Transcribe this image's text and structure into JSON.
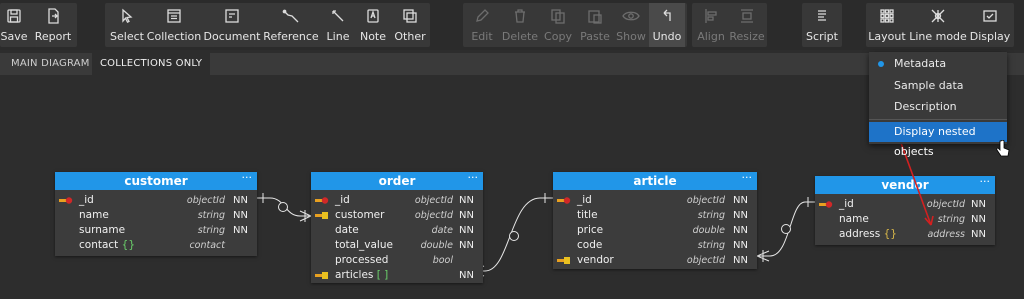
{
  "toolbar": {
    "buttons": [
      {
        "label": "Save",
        "icon": "save-icon"
      },
      {
        "label": "Report",
        "icon": "report-icon"
      },
      {
        "label": "Select",
        "icon": "cursor-icon"
      },
      {
        "label": "Collection",
        "icon": "collection-icon"
      },
      {
        "label": "Document",
        "icon": "document-icon"
      },
      {
        "label": "Reference",
        "icon": "reference-icon"
      },
      {
        "label": "Line",
        "icon": "line-icon"
      },
      {
        "label": "Note",
        "icon": "note-icon"
      },
      {
        "label": "Other",
        "icon": "other-icon"
      },
      {
        "label": "Edit",
        "icon": "edit-icon",
        "disabled": true
      },
      {
        "label": "Delete",
        "icon": "delete-icon",
        "disabled": true
      },
      {
        "label": "Copy",
        "icon": "copy-icon",
        "disabled": true
      },
      {
        "label": "Paste",
        "icon": "paste-icon",
        "disabled": true
      },
      {
        "label": "Show",
        "icon": "eye-icon",
        "disabled": true
      },
      {
        "label": "Undo",
        "icon": "undo-icon"
      },
      {
        "label": "Align",
        "icon": "align-icon",
        "disabled": true
      },
      {
        "label": "Resize",
        "icon": "resize-icon",
        "disabled": true
      },
      {
        "label": "Script",
        "icon": "script-icon"
      },
      {
        "label": "Layout",
        "icon": "layout-icon"
      },
      {
        "label": "Line mode",
        "icon": "line-mode-icon"
      },
      {
        "label": "Display",
        "icon": "display-icon"
      }
    ]
  },
  "tabs": [
    {
      "label": "MAIN DIAGRAM"
    },
    {
      "label": "COLLECTIONS ONLY",
      "active": true
    }
  ],
  "display_menu": {
    "items": [
      {
        "label": "Metadata",
        "selected": true
      },
      {
        "label": "Sample data"
      },
      {
        "label": "Description"
      },
      {
        "label": "Display nested objects",
        "highlighted": true
      }
    ]
  },
  "entities": {
    "customer": {
      "title": "customer",
      "menu": "···",
      "fields": [
        {
          "name": "_id",
          "type": "objectId",
          "nn": "NN",
          "key": "pk"
        },
        {
          "name": "name",
          "type": "string",
          "nn": "NN"
        },
        {
          "name": "surname",
          "type": "string",
          "nn": "NN"
        },
        {
          "name": "contact",
          "suffix": "{}",
          "suffix_kind": "object",
          "type": "contact",
          "nn": ""
        }
      ]
    },
    "order": {
      "title": "order",
      "menu": "···",
      "fields": [
        {
          "name": "_id",
          "type": "objectId",
          "nn": "NN",
          "key": "pk"
        },
        {
          "name": "customer",
          "type": "objectId",
          "nn": "NN",
          "key": "fk"
        },
        {
          "name": "date",
          "type": "date",
          "nn": "NN"
        },
        {
          "name": "total_value",
          "type": "double",
          "nn": "NN"
        },
        {
          "name": "processed",
          "type": "bool",
          "nn": ""
        },
        {
          "name": "articles",
          "suffix": "[ ]",
          "suffix_kind": "array",
          "type": "",
          "nn": "NN",
          "key": "fk"
        }
      ]
    },
    "article": {
      "title": "article",
      "menu": "···",
      "fields": [
        {
          "name": "_id",
          "type": "objectId",
          "nn": "NN",
          "key": "pk"
        },
        {
          "name": "title",
          "type": "string",
          "nn": "NN"
        },
        {
          "name": "price",
          "type": "double",
          "nn": "NN"
        },
        {
          "name": "code",
          "type": "string",
          "nn": "NN"
        },
        {
          "name": "vendor",
          "type": "objectId",
          "nn": "NN",
          "key": "fk"
        }
      ]
    },
    "vendor": {
      "title": "vendor",
      "menu": "···",
      "fields": [
        {
          "name": "_id",
          "type": "objectId",
          "nn": "NN",
          "key": "pk"
        },
        {
          "name": "name",
          "type": "string",
          "nn": "NN"
        },
        {
          "name": "address",
          "suffix": "{}",
          "suffix_kind": "object",
          "type": "address",
          "nn": "NN"
        }
      ]
    }
  },
  "colors": {
    "accent": "#2196e8",
    "menu_highlight": "#1e73c8",
    "object_brace": "#d9b84a",
    "array_bracket": "#6ad16a",
    "annotation_arrow": "#d32020"
  }
}
